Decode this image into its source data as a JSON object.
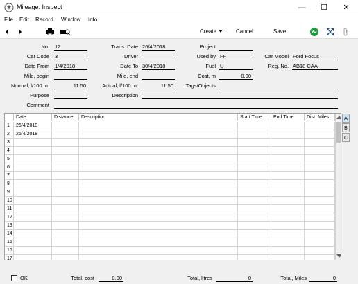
{
  "window": {
    "title": "Mileage: Inspect",
    "min": "—",
    "max": "☐",
    "close": "✕"
  },
  "menu": [
    "File",
    "Edit",
    "Record",
    "Window",
    "Info"
  ],
  "toolbar": {
    "create": "Create",
    "cancel": "Cancel",
    "save": "Save"
  },
  "form": {
    "no": {
      "label": "No.",
      "value": "12"
    },
    "trans_date": {
      "label": "Trans. Date",
      "value": "26/4/2018"
    },
    "project": {
      "label": "Project",
      "value": ""
    },
    "car_code": {
      "label": "Car Code",
      "value": "3"
    },
    "driver": {
      "label": "Driver",
      "value": ""
    },
    "used_by": {
      "label": "Used by",
      "value": "FF"
    },
    "car_model": {
      "label": "Car Model",
      "value": "Ford Focus"
    },
    "date_from": {
      "label": "Date From",
      "value": "1/4/2018"
    },
    "date_to": {
      "label": "Date To",
      "value": "30/4/2018"
    },
    "fuel": {
      "label": "Fuel",
      "value": "U"
    },
    "reg_no": {
      "label": "Reg. No.",
      "value": "AB18 CAA"
    },
    "mile_begin": {
      "label": "Mile, begin",
      "value": ""
    },
    "mile_end": {
      "label": "Mile, end",
      "value": ""
    },
    "cost_m": {
      "label": "Cost, m",
      "value": "0.00"
    },
    "normal": {
      "label": "Normal, l/100 m.",
      "value": "11.50"
    },
    "actual": {
      "label": "Actual, l/100 m.",
      "value": "11.50"
    },
    "tags": {
      "label": "Tags/Objects",
      "value": ""
    },
    "purpose": {
      "label": "Purpose",
      "value": ""
    },
    "description": {
      "label": "Description",
      "value": ""
    },
    "comment": {
      "label": "Comment",
      "value": ""
    }
  },
  "grid": {
    "headers": [
      "Date",
      "Distance",
      "Description",
      "Start Time",
      "End Time",
      "Dist. Miles"
    ],
    "rows": [
      {
        "n": "1",
        "date": "26/4/2018"
      },
      {
        "n": "2",
        "date": "26/4/2018"
      },
      {
        "n": "3",
        "date": ""
      },
      {
        "n": "4",
        "date": ""
      },
      {
        "n": "5",
        "date": ""
      },
      {
        "n": "6",
        "date": ""
      },
      {
        "n": "7",
        "date": ""
      },
      {
        "n": "8",
        "date": ""
      },
      {
        "n": "9",
        "date": ""
      },
      {
        "n": "10",
        "date": ""
      },
      {
        "n": "11",
        "date": ""
      },
      {
        "n": "12",
        "date": ""
      },
      {
        "n": "13",
        "date": ""
      },
      {
        "n": "14",
        "date": ""
      },
      {
        "n": "15",
        "date": ""
      },
      {
        "n": "16",
        "date": ""
      },
      {
        "n": "17",
        "date": ""
      }
    ],
    "tabs": [
      "A",
      "B",
      "C"
    ]
  },
  "footer": {
    "ok_label": "OK",
    "total_cost": {
      "label": "Total, cost",
      "value": "0.00"
    },
    "total_litres": {
      "label": "Total, litres",
      "value": "0"
    },
    "total_miles": {
      "label": "Total, Miles",
      "value": "0"
    }
  }
}
